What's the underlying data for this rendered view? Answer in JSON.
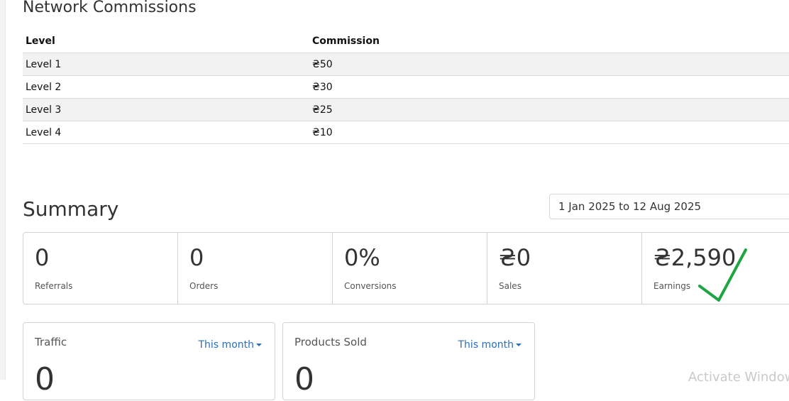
{
  "network_commissions": {
    "title": "Network Commissions",
    "columns": [
      "Level",
      "Commission"
    ],
    "rows": [
      {
        "level": "Level 1",
        "commission": "₴50"
      },
      {
        "level": "Level 2",
        "commission": "₴30"
      },
      {
        "level": "Level 3",
        "commission": "₴25"
      },
      {
        "level": "Level 4",
        "commission": "₴10"
      }
    ]
  },
  "summary": {
    "title": "Summary",
    "date_range": "1 Jan 2025 to 12 Aug 2025",
    "stats": [
      {
        "value": "0",
        "label": "Referrals"
      },
      {
        "value": "0",
        "label": "Orders"
      },
      {
        "value": "0%",
        "label": "Conversions"
      },
      {
        "value": "₴0",
        "label": "Sales"
      },
      {
        "value": "₴2,590",
        "label": "Earnings"
      }
    ],
    "checkmark_color": "#1fa543"
  },
  "cards": {
    "traffic": {
      "title": "Traffic",
      "period": "This month",
      "value": "0"
    },
    "products_sold": {
      "title": "Products Sold",
      "period": "This month",
      "value": "0"
    }
  },
  "watermark": {
    "text": "Activate Windows"
  },
  "colors": {
    "link": "#2a6fb8",
    "border": "#d3d3d3",
    "stripe": "#f2f2f2"
  }
}
